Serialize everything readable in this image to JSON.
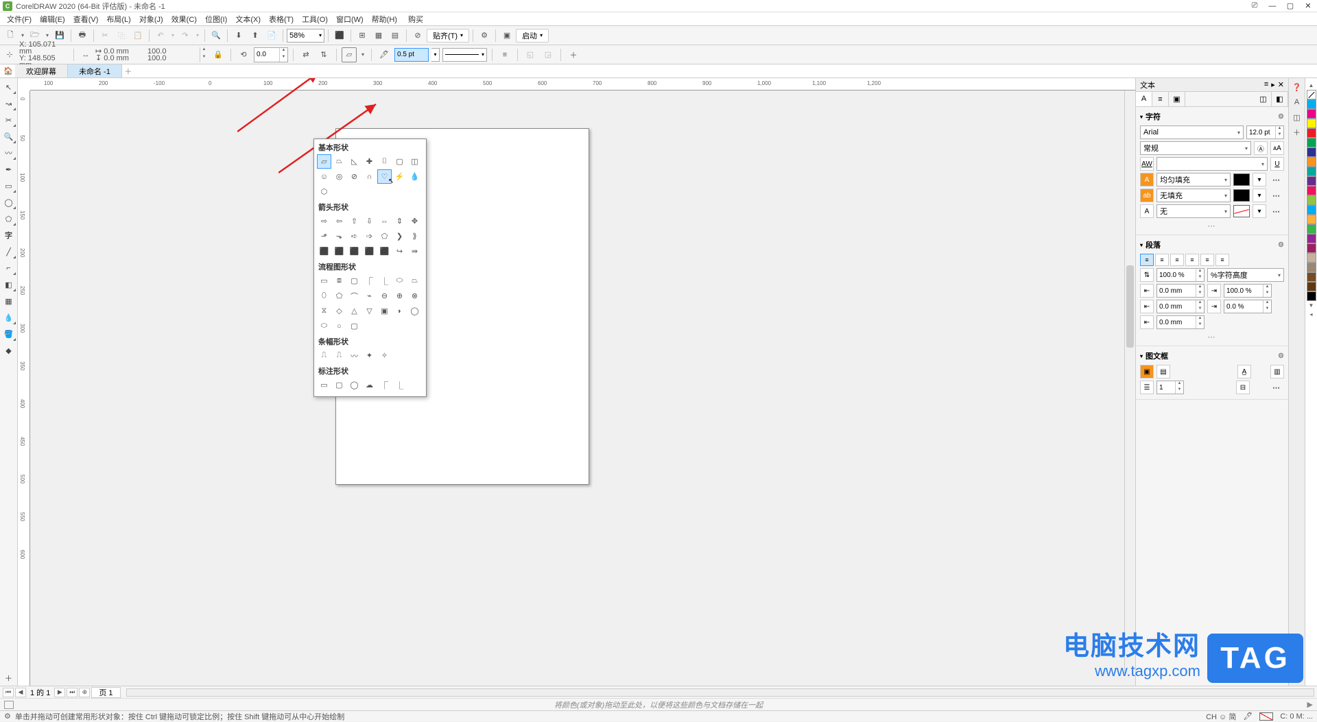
{
  "app": {
    "title": "CorelDRAW 2020 (64-Bit 评估版) - 未命名 -1"
  },
  "menu": {
    "file": "文件(F)",
    "edit": "编辑(E)",
    "view": "查看(V)",
    "layout": "布局(L)",
    "object": "对象(J)",
    "effects": "效果(C)",
    "bitmap": "位图(I)",
    "text": "文本(X)",
    "table": "表格(T)",
    "tools": "工具(O)",
    "window": "窗口(W)",
    "help": "帮助(H)",
    "buy": "购买"
  },
  "toolbar": {
    "zoom": "58%",
    "snap_label": "贴齐(T)",
    "launch_label": "启动"
  },
  "property": {
    "x": "105.071 mm",
    "y": "148.505 mm",
    "w": "0.0 mm",
    "h": "0.0 mm",
    "sx": "100.0",
    "sy": "100.0",
    "rotate": "0.0",
    "outline_width": "0.5 pt"
  },
  "tabs": {
    "welcome": "欢迎屏幕",
    "doc1": "未命名 -1"
  },
  "ruler_marks_h": [
    "100",
    "200",
    "-100",
    "0",
    "100",
    "200",
    "300",
    "400",
    "500",
    "600",
    "700",
    "800",
    "900",
    "1,000",
    "1,100",
    "1,200"
  ],
  "ruler_marks_v": [
    "0",
    "50",
    "100",
    "150",
    "200",
    "250",
    "300",
    "350",
    "400",
    "450",
    "500",
    "550",
    "600"
  ],
  "shapes_panel": {
    "basic": "基本形状",
    "arrow": "箭头形状",
    "flow": "流程图形状",
    "banner": "条幅形状",
    "callout": "标注形状"
  },
  "docker": {
    "title": "文本",
    "sect_char": "字符",
    "font": "Arial",
    "size": "12.0 pt",
    "weight": "常规",
    "fill_uniform": "均匀填充",
    "fill_none": "无填充",
    "outline_none": "无",
    "sect_para": "段落",
    "line_height": "100.0 %",
    "line_height_unit": "%字符高度",
    "indent_left": "0.0 mm",
    "indent_right": "100.0 %",
    "indent_first": "0.0 mm",
    "spacing_pct": "0.0 %",
    "spacing_mm": "0.0 mm",
    "sect_frame": "图文框",
    "columns": "1"
  },
  "pagenav": {
    "label": "1 的 1",
    "page1": "页 1"
  },
  "bottom_hint": "将颜色(或对象)拖动至此处，以便将这些颜色与文档存储在一起",
  "status": {
    "hint": "单击并拖动可创建常用形状对象：按住 Ctrl 键拖动可锁定比例；按住 Shift 键拖动可从中心开始绘制",
    "ime": "CH ☺ 简",
    "cursor": "C: 0  M: ...",
    "url": "www.tagxp.com"
  },
  "watermark": {
    "text1": "电脑技术网",
    "tag": "TAG"
  },
  "palette_colors": [
    "#00AEEF",
    "#EC008C",
    "#FFF200",
    "#ED1C24",
    "#00A651",
    "#2E3192",
    "#F7941D",
    "#00A99D",
    "#662D91",
    "#ED145B",
    "#8DC63F",
    "#00ADEF",
    "#FBB040",
    "#39B54A",
    "#92278F",
    "#9E1F63",
    "#C7B299",
    "#998675",
    "#754C24",
    "#603913",
    "#000000"
  ]
}
